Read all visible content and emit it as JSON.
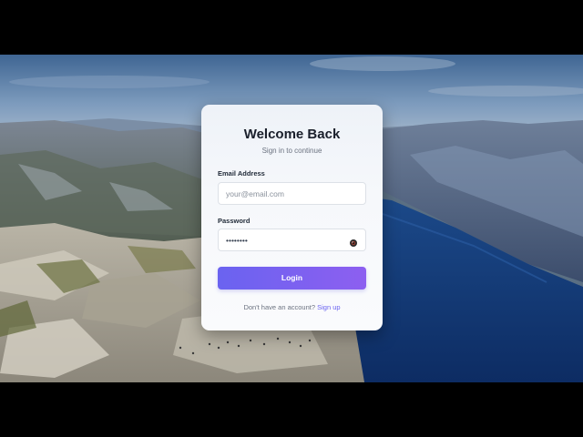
{
  "login": {
    "title": "Welcome Back",
    "subtitle": "Sign in to continue",
    "email_label": "Email Address",
    "email_placeholder": "your@email.com",
    "email_value": "",
    "password_label": "Password",
    "password_value": "••••••••",
    "toggle_icon": "eye-icon",
    "login_label": "Login",
    "signup_prompt": "Don't have an account?",
    "signup_link": "Sign up"
  },
  "colors": {
    "accent_start": "#6a63f0",
    "accent_end": "#8d5ff0",
    "card_bg": "#f6f8fb",
    "title": "#1a1f2b"
  }
}
